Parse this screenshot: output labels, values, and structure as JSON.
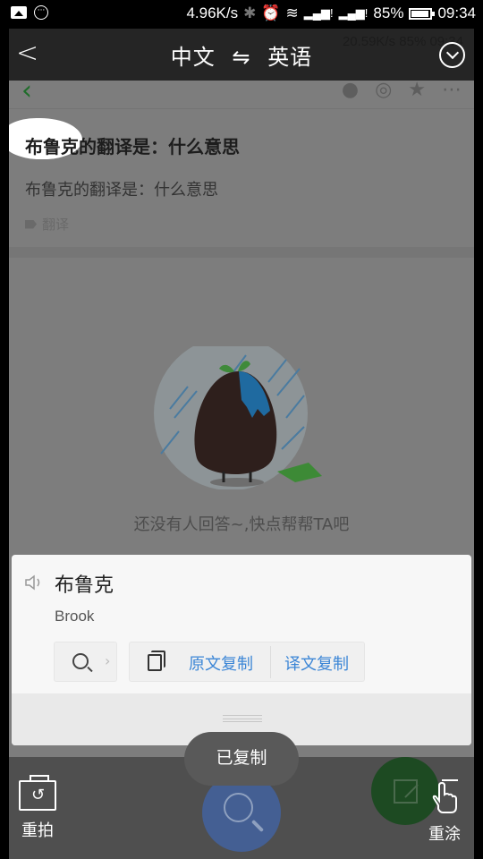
{
  "status_bar": {
    "notification_icons": [
      "image-icon",
      "more-circle-icon"
    ],
    "network_speed": "4.96K/s",
    "battery_percent": "85%",
    "battery_level": 0.85,
    "time": "09:34"
  },
  "background_page": {
    "ghost_status": "20.59K/s     85%  09:34",
    "question_title": "布鲁克的翻译是：什么意思",
    "question_body": "布鲁克的翻译是：什么意思",
    "tag": "翻译",
    "empty_message": "还没有人回答~,快点帮帮TA吧"
  },
  "top_bar": {
    "back_glyph": "<",
    "source_lang": "中文",
    "swap_glyph": "⇋",
    "target_lang": "英语",
    "title": "中文 ⇋ 英语"
  },
  "translation_card": {
    "source_text": "布鲁克",
    "translated_text": "Brook",
    "copy_source_label": "原文复制",
    "copy_translation_label": "译文复制"
  },
  "toast": {
    "message": "已复制"
  },
  "bottom_bar": {
    "retake_label": "重拍",
    "redraw_label": "重涂"
  },
  "colors": {
    "accent_blue": "#3c86d6",
    "search_fab": "#445f93",
    "edit_fab": "#1d4a22"
  }
}
